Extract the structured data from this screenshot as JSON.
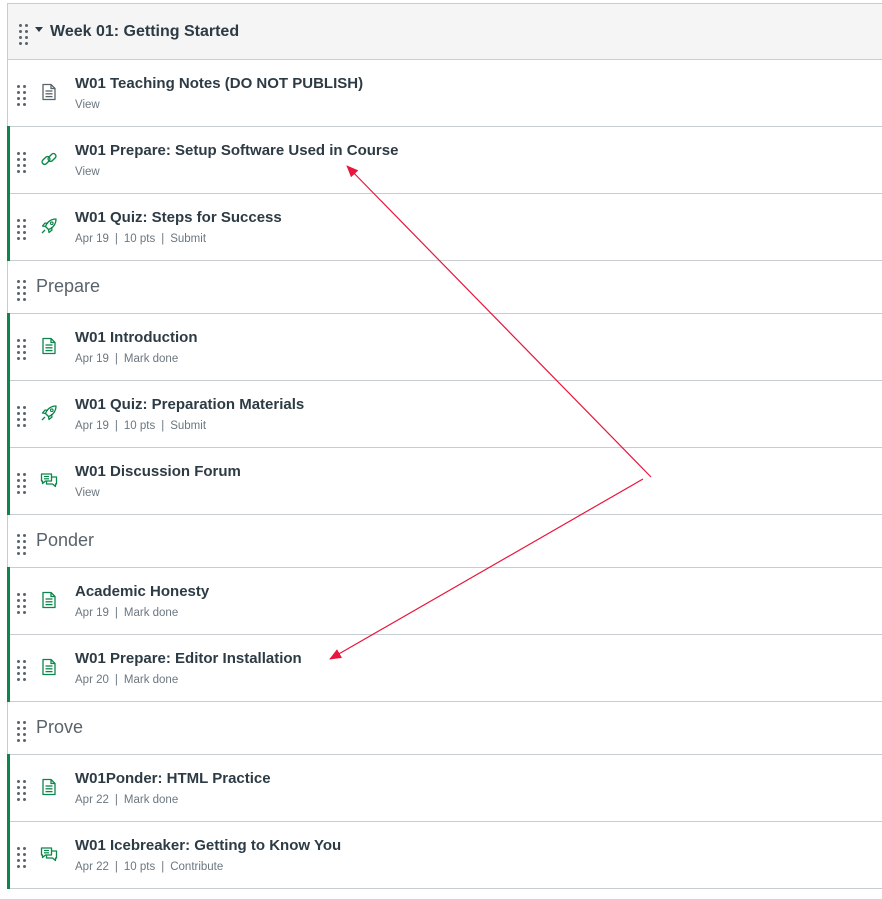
{
  "module": {
    "title": "Week 01: Getting Started",
    "rows": [
      {
        "kind": "item",
        "icon": "page-icon",
        "published": false,
        "title": "W01 Teaching Notes (DO NOT PUBLISH)",
        "meta": [
          "View"
        ]
      },
      {
        "kind": "item",
        "icon": "link-icon",
        "published": true,
        "title": "W01 Prepare: Setup Software Used in Course",
        "meta": [
          "View"
        ]
      },
      {
        "kind": "item",
        "icon": "quiz-rocket-icon",
        "published": true,
        "title": "W01 Quiz: Steps for Success",
        "meta": [
          "Apr 19",
          "10 pts",
          "Submit"
        ]
      },
      {
        "kind": "header",
        "title": "Prepare"
      },
      {
        "kind": "item",
        "icon": "page-icon",
        "published": true,
        "title": "W01 Introduction",
        "meta": [
          "Apr 19",
          "Mark done"
        ]
      },
      {
        "kind": "item",
        "icon": "quiz-rocket-icon",
        "published": true,
        "title": "W01 Quiz: Preparation Materials",
        "meta": [
          "Apr 19",
          "10 pts",
          "Submit"
        ]
      },
      {
        "kind": "item",
        "icon": "discussion-icon",
        "published": true,
        "title": "W01 Discussion Forum",
        "meta": [
          "View"
        ]
      },
      {
        "kind": "header",
        "title": "Ponder"
      },
      {
        "kind": "item",
        "icon": "page-icon",
        "published": true,
        "title": "Academic Honesty",
        "meta": [
          "Apr 19",
          "Mark done"
        ]
      },
      {
        "kind": "item",
        "icon": "page-icon",
        "published": true,
        "title": "W01 Prepare: Editor Installation",
        "meta": [
          "Apr 20",
          "Mark done"
        ]
      },
      {
        "kind": "header",
        "title": "Prove"
      },
      {
        "kind": "item",
        "icon": "page-icon",
        "published": true,
        "title": "W01Ponder: HTML Practice",
        "meta": [
          "Apr 22",
          "Mark done"
        ]
      },
      {
        "kind": "item",
        "icon": "discussion-icon",
        "published": true,
        "title": "W01 Icebreaker: Getting to Know You",
        "meta": [
          "Apr 22",
          "10 pts",
          "Contribute"
        ]
      }
    ]
  },
  "colors": {
    "published": "#0b874b",
    "icon_unpublished": "#59636b",
    "annotation": "#e8163c"
  },
  "annotation": {
    "type": "arrows",
    "description_count": 2
  }
}
